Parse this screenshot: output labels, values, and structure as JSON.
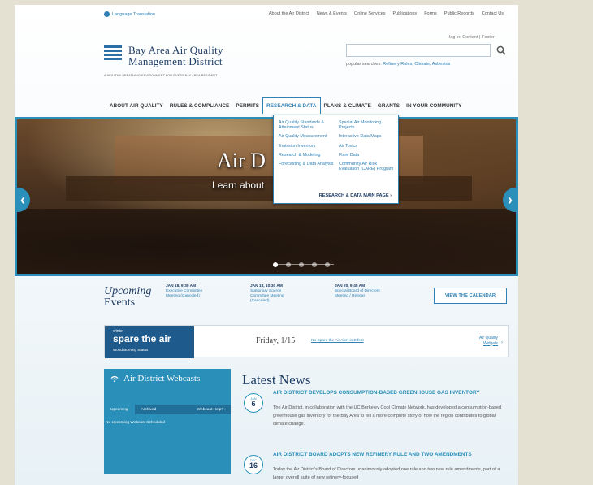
{
  "utility": {
    "language": "Language Translation",
    "links": [
      "About the Air District",
      "News & Events",
      "Online Services",
      "Publications",
      "Forms",
      "Public Records",
      "Contact Us"
    ]
  },
  "header": {
    "logo_line1": "Bay Area Air Quality",
    "logo_line2": "Management District",
    "tagline": "A HEALTHY BREATHING ENVIRONMENT FOR EVERY BAY AREA RESIDENT",
    "signin": "log in: Content | Footer",
    "search_value": "",
    "popular_label": "popular searches:",
    "popular_links": "Refinery Rules, Climate, Asbestos"
  },
  "nav": {
    "items": [
      "ABOUT AIR QUALITY",
      "RULES & COMPLIANCE",
      "PERMITS",
      "RESEARCH & DATA",
      "PLANS & CLIMATE",
      "GRANTS",
      "IN YOUR COMMUNITY"
    ],
    "active": "RESEARCH & DATA"
  },
  "dropdown": {
    "left": [
      "Air Quality Standards & Attainment Status",
      "Air Quality Measurement",
      "Emission Inventory",
      "Research & Modeling",
      "Forecasting & Data Analysis"
    ],
    "right": [
      "Special Air Monitoring Projects",
      "Interactive Data Maps",
      "Air Toxics",
      "Flare Data",
      "Community Air Risk Evaluation (CARE) Program"
    ],
    "main_page": "RESEARCH & DATA MAIN PAGE ›"
  },
  "hero": {
    "title": "Air D",
    "subtitle": "Learn about"
  },
  "events": {
    "heading_1": "Upcoming",
    "heading_2": "Events",
    "items": [
      {
        "date": "JAN 18, 9:30 AM",
        "title": "Executive Committee Meeting (Canceled)"
      },
      {
        "date": "JAN 18, 10:30 AM",
        "title": "Stationary Source Committee Meeting (Canceled)"
      },
      {
        "date": "JAN 20, 9:45 AM",
        "title": "Special Board of Directors Meeting / Retreat"
      }
    ],
    "view_calendar": "VIEW THE CALENDAR"
  },
  "spare": {
    "winter": "winter",
    "brand": "spare the air",
    "status": "Wood Burning Status",
    "date": "Friday, 1/15",
    "alert": "No Spare the Air Alert in Effect",
    "widgets": "Air Quality Widgets"
  },
  "webcasts": {
    "title": "Air District Webcasts",
    "tabs": [
      "Upcoming",
      "Archived"
    ],
    "help": "Webcast Help? ›",
    "empty": "No Upcoming Webcast Scheduled"
  },
  "news": {
    "title": "Latest News",
    "items": [
      {
        "month": "JAN",
        "day": "6",
        "headline": "AIR DISTRICT DEVELOPS CONSUMPTION-BASED GREENHOUSE GAS INVENTORY",
        "body": "The Air District, in collaboration with the UC Berkeley Cool Climate Network, has developed a consumption-based greenhouse gas inventory for the Bay Area to tell a more complete story of how the region contributes to global climate change."
      },
      {
        "month": "DEC",
        "day": "16",
        "headline": "AIR DISTRICT BOARD ADOPTS NEW REFINERY RULE AND TWO AMENDMENTS",
        "body": "Today the Air District's Board of Directors unanimously adopted one rule and two new rule amendments, part of a larger overall suite of new refinery-focused"
      }
    ]
  },
  "colors": {
    "accent": "#2a8fb9",
    "navy": "#1e3c64",
    "page_bg": "#e4e1d3"
  }
}
